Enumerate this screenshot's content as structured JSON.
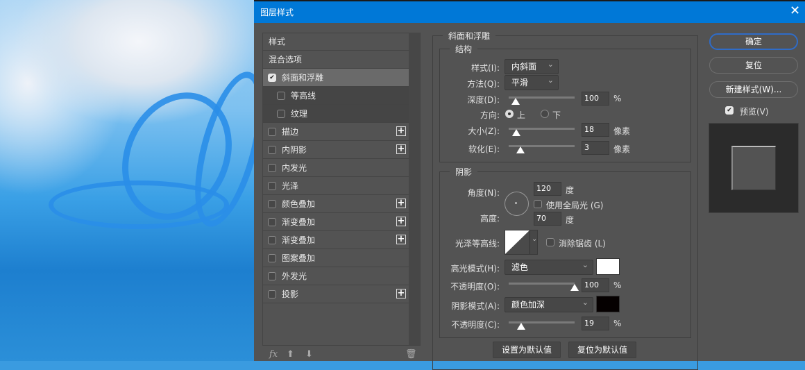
{
  "dialog": {
    "title": "图层样式",
    "close_icon": "close-icon"
  },
  "sidebar": {
    "items": [
      {
        "label": "样式",
        "checkbox": false,
        "checked": false,
        "plus": false
      },
      {
        "label": "混合选项",
        "checkbox": false,
        "checked": false,
        "plus": false
      },
      {
        "label": "斜面和浮雕",
        "checkbox": true,
        "checked": true,
        "plus": false,
        "selected": true
      },
      {
        "label": "等高线",
        "checkbox": true,
        "checked": false,
        "plus": false,
        "sub": true
      },
      {
        "label": "纹理",
        "checkbox": true,
        "checked": false,
        "plus": false,
        "sub": true
      },
      {
        "label": "描边",
        "checkbox": true,
        "checked": false,
        "plus": true
      },
      {
        "label": "内阴影",
        "checkbox": true,
        "checked": false,
        "plus": true
      },
      {
        "label": "内发光",
        "checkbox": true,
        "checked": false,
        "plus": false
      },
      {
        "label": "光泽",
        "checkbox": true,
        "checked": false,
        "plus": false
      },
      {
        "label": "颜色叠加",
        "checkbox": true,
        "checked": false,
        "plus": true
      },
      {
        "label": "渐变叠加",
        "checkbox": true,
        "checked": false,
        "plus": true
      },
      {
        "label": "渐变叠加",
        "checkbox": true,
        "checked": false,
        "plus": true
      },
      {
        "label": "图案叠加",
        "checkbox": true,
        "checked": false,
        "plus": false
      },
      {
        "label": "外发光",
        "checkbox": true,
        "checked": false,
        "plus": false
      },
      {
        "label": "投影",
        "checkbox": true,
        "checked": false,
        "plus": true
      }
    ],
    "footer": {
      "fx": "fx",
      "up": "⬆",
      "down": "⬇",
      "trash": "🗑"
    }
  },
  "bevel": {
    "title": "斜面和浮雕",
    "structure": {
      "title": "结构",
      "style_label": "样式(I):",
      "style_value": "内斜面",
      "technique_label": "方法(Q):",
      "technique_value": "平滑",
      "depth_label": "深度(D):",
      "depth_value": "100",
      "depth_unit": "%",
      "depth_slider": 0.1,
      "direction_label": "方向:",
      "dir_up": "上",
      "dir_down": "下",
      "direction": "up",
      "size_label": "大小(Z):",
      "size_value": "18",
      "size_unit": "像素",
      "size_slider": 0.12,
      "soften_label": "软化(E):",
      "soften_value": "3",
      "soften_unit": "像素",
      "soften_slider": 0.18
    },
    "shading": {
      "title": "阴影",
      "angle_label": "角度(N):",
      "angle_value": "120",
      "angle_unit": "度",
      "global_light_label": "使用全局光 (G)",
      "global_light": false,
      "altitude_label": "高度:",
      "altitude_value": "70",
      "altitude_unit": "度",
      "gloss_label": "光泽等高线:",
      "antialias_label": "消除锯齿 (L)",
      "antialias": false,
      "highlight_label": "高光模式(H):",
      "highlight_mode": "滤色",
      "highlight_color": "#ffffff",
      "highlight_opacity_label": "不透明度(O):",
      "highlight_opacity": "100",
      "highlight_opacity_unit": "%",
      "highlight_slider": 1.0,
      "shadow_label": "阴影模式(A):",
      "shadow_mode": "颜色加深",
      "shadow_color": "#050000",
      "shadow_opacity_label": "不透明度(C):",
      "shadow_opacity": "19",
      "shadow_opacity_unit": "%",
      "shadow_slider": 0.19
    },
    "make_default": "设置为默认值",
    "reset_default": "复位为默认值"
  },
  "right": {
    "ok": "确定",
    "reset": "复位",
    "new_style": "新建样式(W)...",
    "preview_label": "预览(V)",
    "preview_checked": true
  },
  "colors": {
    "titlebar": "#0078d7",
    "panel": "#535353"
  }
}
